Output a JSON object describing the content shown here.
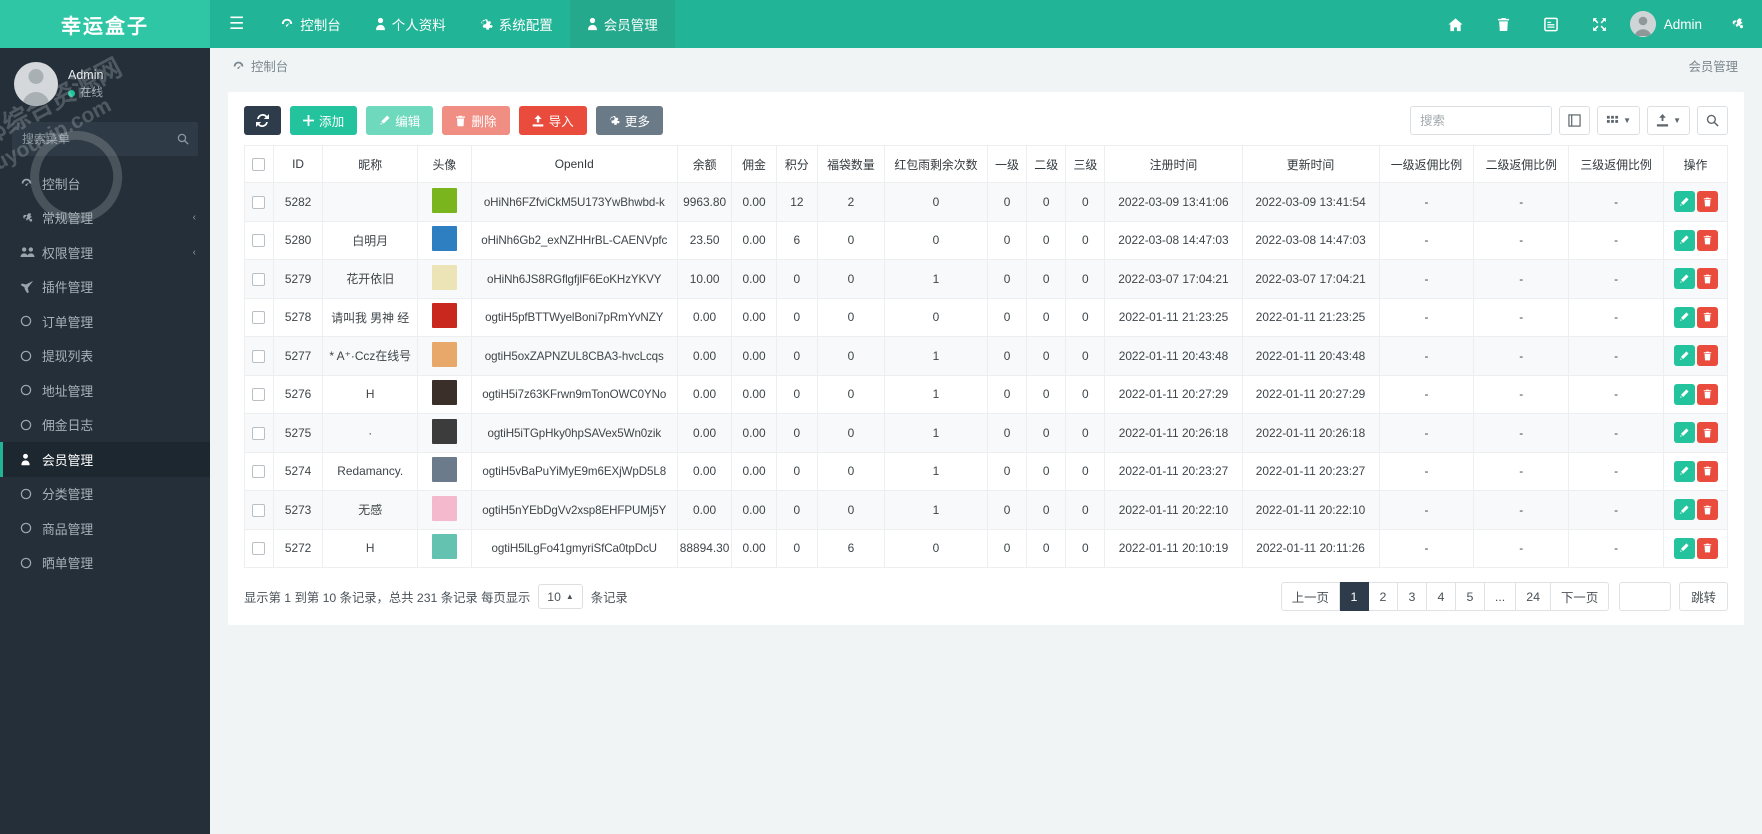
{
  "brand": {
    "title": "幸运盒子"
  },
  "topnav": {
    "hamburger_icon": "hamburger-icon",
    "items": [
      {
        "label": "控制台",
        "icon": "dashboard-icon",
        "active": false
      },
      {
        "label": "个人资料",
        "icon": "user-icon",
        "active": false
      },
      {
        "label": "系统配置",
        "icon": "gear-icon",
        "active": false
      },
      {
        "label": "会员管理",
        "icon": "user-icon",
        "active": true
      }
    ],
    "right_icons": [
      "home-icon",
      "trash-icon",
      "window-icon",
      "fullscreen-icon"
    ],
    "user_label": "Admin",
    "settings_icon": "cogs-icon"
  },
  "sidebar": {
    "user": {
      "name": "Admin",
      "status": "在线"
    },
    "search_placeholder": "搜索菜单",
    "search_value": "",
    "items": [
      {
        "label": "控制台",
        "icon": "dashboard-icon",
        "caret": "",
        "active": false
      },
      {
        "label": "常规管理",
        "icon": "cogs-icon",
        "caret": "‹",
        "active": false
      },
      {
        "label": "权限管理",
        "icon": "users-icon",
        "caret": "‹",
        "active": false
      },
      {
        "label": "插件管理",
        "icon": "plugin-icon",
        "caret": "",
        "active": false
      },
      {
        "label": "订单管理",
        "icon": "circle-icon",
        "caret": "",
        "active": false
      },
      {
        "label": "提现列表",
        "icon": "circle-icon",
        "caret": "",
        "active": false
      },
      {
        "label": "地址管理",
        "icon": "circle-icon",
        "caret": "",
        "active": false
      },
      {
        "label": "佣金日志",
        "icon": "circle-icon",
        "caret": "",
        "active": false
      },
      {
        "label": "会员管理",
        "icon": "user-icon",
        "caret": "",
        "active": true
      },
      {
        "label": "分类管理",
        "icon": "circle-icon",
        "caret": "",
        "active": false
      },
      {
        "label": "商品管理",
        "icon": "circle-icon",
        "caret": "",
        "active": false
      },
      {
        "label": "晒单管理",
        "icon": "circle-icon",
        "caret": "",
        "active": false
      }
    ],
    "watermark_line1": "网部综合资源网",
    "watermark_line2": "douyouvip.com"
  },
  "breadcrumb": {
    "left": "控制台",
    "left_icon": "dashboard-icon",
    "right": "会员管理"
  },
  "toolbar": {
    "refresh_label": "",
    "refresh_icon": "refresh-icon",
    "buttons": [
      {
        "label": "添加",
        "icon": "plus-icon",
        "style": "green"
      },
      {
        "label": "编辑",
        "icon": "pencil-icon",
        "style": "green-light"
      },
      {
        "label": "删除",
        "icon": "trash-icon",
        "style": "red-light"
      },
      {
        "label": "导入",
        "icon": "upload-icon",
        "style": "red"
      },
      {
        "label": "更多",
        "icon": "gear-icon",
        "style": "grey"
      }
    ],
    "search_placeholder": "搜索",
    "search_value": "",
    "right_icons": [
      "fullscreen-table-icon",
      "columns-icon",
      "export-icon",
      "search-icon"
    ]
  },
  "table": {
    "columns": [
      "ID",
      "昵称",
      "头像",
      "OpenId",
      "余额",
      "佣金",
      "积分",
      "福袋数量",
      "红包雨剩余次数",
      "一级",
      "二级",
      "三级",
      "注册时间",
      "更新时间",
      "一级返佣比例",
      "二级返佣比例",
      "三级返佣比例",
      "操作"
    ],
    "rows": [
      {
        "id": "5282",
        "nick": "",
        "avatar_color": "#7ab51d",
        "openid": "oHiNh6FZfviCkM5U173YwBhwbd-k",
        "balance": "9963.80",
        "commission": "0.00",
        "points": "12",
        "bags": "2",
        "rain": "0",
        "l1": "0",
        "l2": "0",
        "l3": "0",
        "reg_time": "2022-03-09 13:41:06",
        "upd_time": "2022-03-09 13:41:54",
        "r1": "-",
        "r2": "-",
        "r3": "-"
      },
      {
        "id": "5280",
        "nick": "白明月",
        "avatar_color": "#2e7fc1",
        "openid": "oHiNh6Gb2_exNZHHrBL-CAENVpfc",
        "balance": "23.50",
        "commission": "0.00",
        "points": "6",
        "bags": "0",
        "rain": "0",
        "l1": "0",
        "l2": "0",
        "l3": "0",
        "reg_time": "2022-03-08 14:47:03",
        "upd_time": "2022-03-08 14:47:03",
        "r1": "-",
        "r2": "-",
        "r3": "-"
      },
      {
        "id": "5279",
        "nick": "花开依旧",
        "avatar_color": "#ece3b6",
        "openid": "oHiNh6JS8RGflgfjlF6EoKHzYKVY",
        "balance": "10.00",
        "commission": "0.00",
        "points": "0",
        "bags": "0",
        "rain": "1",
        "l1": "0",
        "l2": "0",
        "l3": "0",
        "reg_time": "2022-03-07 17:04:21",
        "upd_time": "2022-03-07 17:04:21",
        "r1": "-",
        "r2": "-",
        "r3": "-"
      },
      {
        "id": "5278",
        "nick": "请叫我 男神 经",
        "avatar_color": "#c8281d",
        "openid": "ogtiH5pfBTTWyelBoni7pRmYvNZY",
        "balance": "0.00",
        "commission": "0.00",
        "points": "0",
        "bags": "0",
        "rain": "0",
        "l1": "0",
        "l2": "0",
        "l3": "0",
        "reg_time": "2022-01-11 21:23:25",
        "upd_time": "2022-01-11 21:23:25",
        "r1": "-",
        "r2": "-",
        "r3": "-"
      },
      {
        "id": "5277",
        "nick": "* A⁺·Ccz在线号",
        "avatar_color": "#e8a86a",
        "openid": "ogtiH5oxZAPNZUL8CBA3-hvcLcqs",
        "balance": "0.00",
        "commission": "0.00",
        "points": "0",
        "bags": "0",
        "rain": "1",
        "l1": "0",
        "l2": "0",
        "l3": "0",
        "reg_time": "2022-01-11 20:43:48",
        "upd_time": "2022-01-11 20:43:48",
        "r1": "-",
        "r2": "-",
        "r3": "-"
      },
      {
        "id": "5276",
        "nick": "H",
        "avatar_color": "#3b2f2a",
        "openid": "ogtiH5i7z63KFrwn9mTonOWC0YNo",
        "balance": "0.00",
        "commission": "0.00",
        "points": "0",
        "bags": "0",
        "rain": "1",
        "l1": "0",
        "l2": "0",
        "l3": "0",
        "reg_time": "2022-01-11 20:27:29",
        "upd_time": "2022-01-11 20:27:29",
        "r1": "-",
        "r2": "-",
        "r3": "-"
      },
      {
        "id": "5275",
        "nick": "·",
        "avatar_color": "#3c3c3c",
        "openid": "ogtiH5iTGpHky0hpSAVex5Wn0zik",
        "balance": "0.00",
        "commission": "0.00",
        "points": "0",
        "bags": "0",
        "rain": "1",
        "l1": "0",
        "l2": "0",
        "l3": "0",
        "reg_time": "2022-01-11 20:26:18",
        "upd_time": "2022-01-11 20:26:18",
        "r1": "-",
        "r2": "-",
        "r3": "-"
      },
      {
        "id": "5274",
        "nick": "Redamancy.",
        "avatar_color": "#6b7b8c",
        "openid": "ogtiH5vBaPuYiMyE9m6EXjWpD5L8",
        "balance": "0.00",
        "commission": "0.00",
        "points": "0",
        "bags": "0",
        "rain": "1",
        "l1": "0",
        "l2": "0",
        "l3": "0",
        "reg_time": "2022-01-11 20:23:27",
        "upd_time": "2022-01-11 20:23:27",
        "r1": "-",
        "r2": "-",
        "r3": "-"
      },
      {
        "id": "5273",
        "nick": "无感",
        "avatar_color": "#f5b9cd",
        "openid": "ogtiH5nYEbDgVv2xsp8EHFPUMj5Y",
        "balance": "0.00",
        "commission": "0.00",
        "points": "0",
        "bags": "0",
        "rain": "1",
        "l1": "0",
        "l2": "0",
        "l3": "0",
        "reg_time": "2022-01-11 20:22:10",
        "upd_time": "2022-01-11 20:22:10",
        "r1": "-",
        "r2": "-",
        "r3": "-"
      },
      {
        "id": "5272",
        "nick": "H",
        "avatar_color": "#63c2b0",
        "openid": "ogtiH5lLgFo41gmyriSfCa0tpDcU",
        "balance": "88894.30",
        "commission": "0.00",
        "points": "0",
        "bags": "6",
        "rain": "0",
        "l1": "0",
        "l2": "0",
        "l3": "0",
        "reg_time": "2022-01-11 20:10:19",
        "upd_time": "2022-01-11 20:11:26",
        "r1": "-",
        "r2": "-",
        "r3": "-"
      }
    ],
    "row_actions": {
      "edit_icon": "pencil-icon",
      "delete_icon": "trash-icon"
    }
  },
  "footer": {
    "info_prefix": "显示第 1 到第 10 条记录，总共 231 条记录 每页显示",
    "page_size": "10",
    "info_suffix": "条记录",
    "prev_label": "上一页",
    "next_label": "下一页",
    "pages": [
      "1",
      "2",
      "3",
      "4",
      "5",
      "...",
      "24"
    ],
    "current_page": "1",
    "jump_value": "",
    "jump_label": "跳转"
  },
  "colors": {
    "brand_green": "#2ec6a5",
    "header_green": "#21b496",
    "sidebar_dark": "#242f39",
    "accent_dark": "#2e3b4a",
    "danger": "#e94b3c"
  }
}
